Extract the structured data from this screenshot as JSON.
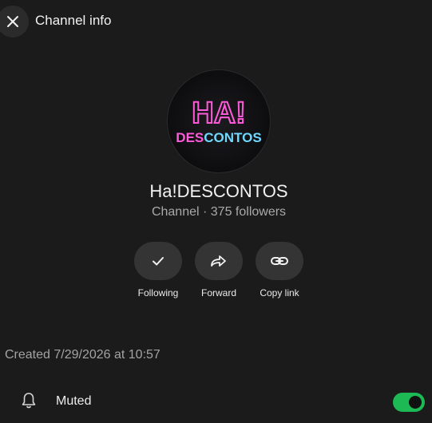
{
  "header": {
    "title": "Channel info",
    "close_icon": "close-icon"
  },
  "channel": {
    "logo_text_top": "HA!",
    "logo_text_bottom_pink": "DES",
    "logo_text_bottom_blue": "CONTOS",
    "name": "Ha!DESCONTOS",
    "subtitle": "Channel · 375 followers"
  },
  "actions": [
    {
      "label": "Following",
      "icon": "check-icon"
    },
    {
      "label": "Forward",
      "icon": "forward-icon"
    },
    {
      "label": "Copy link",
      "icon": "link-icon"
    }
  ],
  "details": {
    "created": "Created 7/29/2026 at 10:57"
  },
  "settings": {
    "muted_label": "Muted",
    "muted_icon": "bell-icon",
    "muted_on": true
  },
  "colors": {
    "background": "#1b1b1b",
    "toggle_on": "#1db954",
    "neon_pink": "#ff5ad9",
    "neon_blue": "#6fd8ff"
  }
}
